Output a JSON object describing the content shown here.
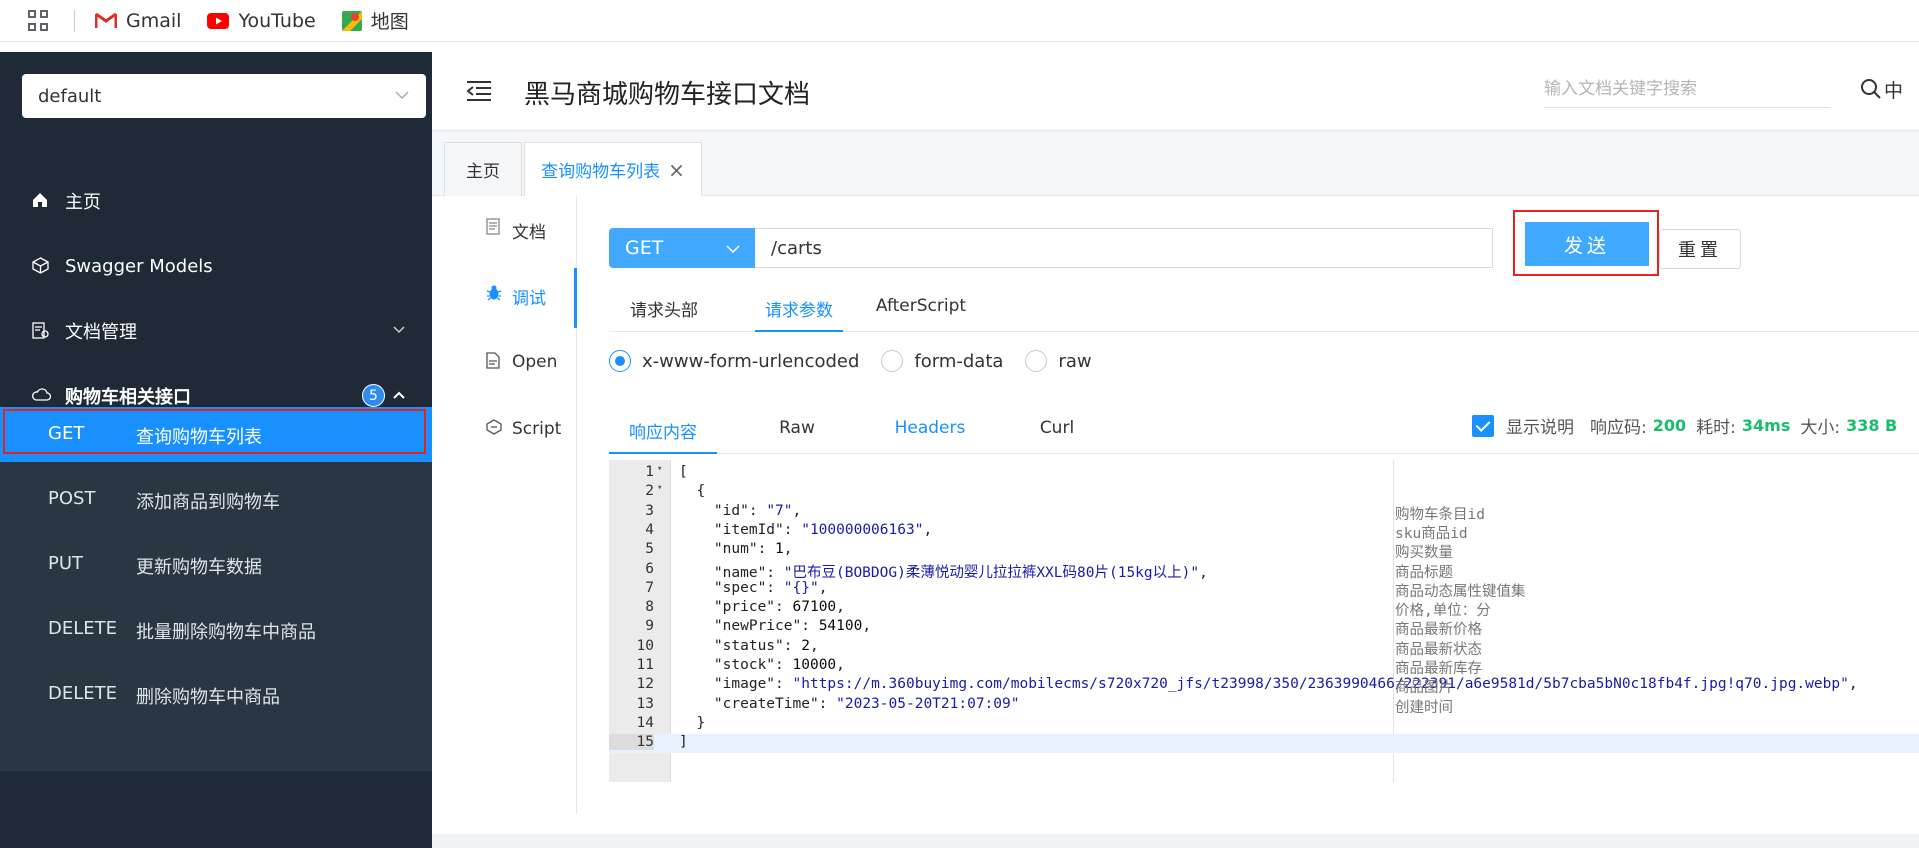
{
  "bookmarks": [
    {
      "label": "Gmail",
      "icon": "gmail-icon"
    },
    {
      "label": "YouTube",
      "icon": "youtube-icon"
    },
    {
      "label": "地图",
      "icon": "maps-icon"
    }
  ],
  "sidebar": {
    "group_select": "default",
    "menu": [
      {
        "label": "主页",
        "icon": "home-icon"
      },
      {
        "label": "Swagger Models",
        "icon": "cube-icon"
      },
      {
        "label": "文档管理",
        "icon": "doc-manage-icon"
      },
      {
        "label": "购物车相关接口",
        "icon": "cloud-icon",
        "badge": "5"
      }
    ],
    "endpoints": [
      {
        "method": "GET",
        "name": "查询购物车列表",
        "active": true
      },
      {
        "method": "POST",
        "name": "添加商品到购物车"
      },
      {
        "method": "PUT",
        "name": "更新购物车数据"
      },
      {
        "method": "DELETE",
        "name": "批量删除购物车中商品"
      },
      {
        "method": "DELETE",
        "name": "删除购物车中商品"
      }
    ]
  },
  "header": {
    "title": "黑马商城购物车接口文档",
    "search_placeholder": "输入文档关键字搜索",
    "lang": "中"
  },
  "tabs": [
    {
      "label": "主页"
    },
    {
      "label": "查询购物车列表",
      "active": true,
      "close": "×"
    }
  ],
  "vnav": [
    {
      "label": "文档",
      "icon": "document-icon"
    },
    {
      "label": "调试",
      "icon": "bug-icon",
      "active": true
    },
    {
      "label": "Open",
      "icon": "file-icon"
    },
    {
      "label": "Script",
      "icon": "code-icon"
    }
  ],
  "request": {
    "method": "GET",
    "url": "/carts",
    "send_label": "发送",
    "reset_label": "重置",
    "tabs": [
      "请求头部",
      "请求参数",
      "AfterScript"
    ],
    "active_tab": "请求参数",
    "content_types": [
      "x-www-form-urlencoded",
      "form-data",
      "raw"
    ],
    "selected_content_type": "x-www-form-urlencoded"
  },
  "response": {
    "tabs": [
      "响应内容",
      "Raw",
      "Headers",
      "Curl"
    ],
    "active_tab": "响应内容",
    "show_desc_label": "显示说明",
    "show_desc_checked": true,
    "status_label": "响应码:",
    "status": "200",
    "time_label": "耗时:",
    "time": "34ms",
    "size_label": "大小:",
    "size": "338 B",
    "lines": [
      {
        "n": "1",
        "fold": "▾",
        "code": "[",
        "anno": ""
      },
      {
        "n": "2",
        "fold": "▾",
        "code": "  {",
        "anno": ""
      },
      {
        "n": "3",
        "fold": "",
        "key": "    \"id\"",
        "val": "\"7\"",
        "tail": ",",
        "anno": "购物车条目id"
      },
      {
        "n": "4",
        "fold": "",
        "key": "    \"itemId\"",
        "val": "\"100000006163\"",
        "tail": ",",
        "anno": "sku商品id"
      },
      {
        "n": "5",
        "fold": "",
        "key": "    \"num\"",
        "val": "1",
        "tail": ",",
        "anno": "购买数量"
      },
      {
        "n": "6",
        "fold": "",
        "key": "    \"name\"",
        "val": "\"巴布豆(BOBDOG)柔薄悦动婴儿拉拉裤XXL码80片(15kg以上)\"",
        "tail": ",",
        "anno": "商品标题"
      },
      {
        "n": "7",
        "fold": "",
        "key": "    \"spec\"",
        "val": "\"{}\"",
        "tail": ",",
        "anno": "商品动态属性键值集"
      },
      {
        "n": "8",
        "fold": "",
        "key": "    \"price\"",
        "val": "67100",
        "tail": ",",
        "anno": "价格,单位：分"
      },
      {
        "n": "9",
        "fold": "",
        "key": "    \"newPrice\"",
        "val": "54100",
        "tail": ",",
        "anno": "商品最新价格"
      },
      {
        "n": "10",
        "fold": "",
        "key": "    \"status\"",
        "val": "2",
        "tail": ",",
        "anno": "商品最新状态"
      },
      {
        "n": "11",
        "fold": "",
        "key": "    \"stock\"",
        "val": "10000",
        "tail": ",",
        "anno": "商品最新库存"
      },
      {
        "n": "12",
        "fold": "",
        "key": "    \"image\"",
        "val": "\"https://m.360buyimg.com/mobilecms/s720x720_jfs/t23998/350/2363990466/222391/a6e9581d/5b7cba5bN0c18fb4f.jpg!q70.jpg.webp\"",
        "tail": ",",
        "anno": "商品图片"
      },
      {
        "n": "13",
        "fold": "",
        "key": "    \"createTime\"",
        "val": "\"2023-05-20T21:07:09\"",
        "tail": "",
        "anno": "创建时间"
      },
      {
        "n": "14",
        "fold": "",
        "code": "  }",
        "anno": ""
      },
      {
        "n": "15",
        "fold": "",
        "code": "]",
        "anno": ""
      }
    ]
  },
  "colors": {
    "accent": "#1890ff",
    "sidebar": "#1f2a36",
    "highlight": "#e02424",
    "success": "#19be6b"
  }
}
